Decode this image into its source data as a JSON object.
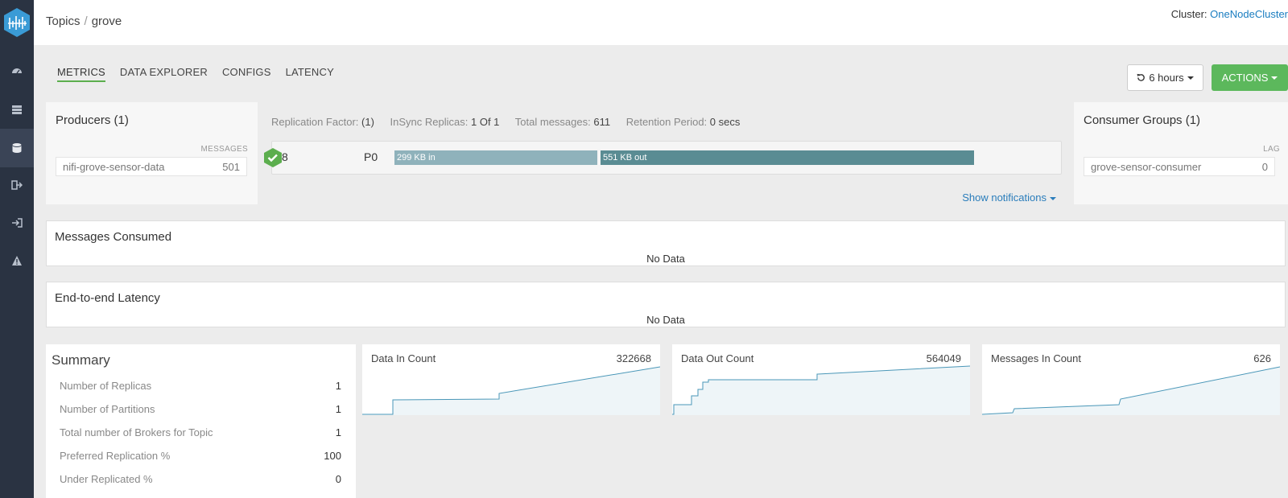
{
  "header": {
    "breadcrumb_root": "Topics",
    "breadcrumb_sep": "/",
    "breadcrumb_current": "grove",
    "cluster_label": "Cluster:",
    "cluster_name": "OneNodeCluster"
  },
  "sidebar": {
    "items": [
      {
        "icon": "dashboard-icon"
      },
      {
        "icon": "brokers-icon"
      },
      {
        "icon": "topics-icon",
        "active": true
      },
      {
        "icon": "producers-icon"
      },
      {
        "icon": "consumers-icon"
      },
      {
        "icon": "alerts-icon"
      }
    ]
  },
  "tabs": [
    "METRICS",
    "DATA EXPLORER",
    "CONFIGS",
    "LATENCY"
  ],
  "toolbar": {
    "time_range": "6 hours",
    "actions_label": "ACTIONS"
  },
  "producers": {
    "title": "Producers (1)",
    "column": "MESSAGES",
    "items": [
      {
        "name": "nifi-grove-sensor-data",
        "value": "501"
      }
    ]
  },
  "consumers": {
    "title": "Consumer Groups (1)",
    "column": "LAG",
    "items": [
      {
        "name": "grove-sensor-consumer",
        "value": "0"
      }
    ]
  },
  "replication": {
    "factor_label": "Replication Factor:",
    "factor_value": "(1)",
    "insync_label": "InSync Replicas:",
    "insync_value": "1 Of 1",
    "total_label": "Total messages:",
    "total_value": "611",
    "retention_label": "Retention Period:",
    "retention_value": "0 secs"
  },
  "partition": {
    "broker": "8",
    "name": "P0",
    "in_label": "299 KB in",
    "out_label": "551 KB out",
    "in_kb": 299,
    "out_kb": 551
  },
  "show_notifications": "Show notifications",
  "panels": {
    "consumed_title": "Messages Consumed",
    "consumed_empty": "No Data",
    "latency_title": "End-to-end Latency",
    "latency_empty": "No Data"
  },
  "summary": {
    "title": "Summary",
    "rows": [
      {
        "label": "Number of Replicas",
        "value": "1"
      },
      {
        "label": "Number of Partitions",
        "value": "1"
      },
      {
        "label": "Total number of Brokers for Topic",
        "value": "1"
      },
      {
        "label": "Preferred Replication %",
        "value": "100"
      },
      {
        "label": "Under Replicated %",
        "value": "0"
      }
    ]
  },
  "metrics": [
    {
      "label": "Data In Count",
      "value": "322668"
    },
    {
      "label": "Data Out Count",
      "value": "564049"
    },
    {
      "label": "Messages In Count",
      "value": "626"
    }
  ],
  "colors": {
    "sidebar": "#2a3342",
    "accent_green": "#5cb85c",
    "link_blue": "#1a7dc0",
    "bar_in": "#8fb2bb",
    "bar_out": "#5a8c93",
    "sparkline": "#4a97b8"
  }
}
